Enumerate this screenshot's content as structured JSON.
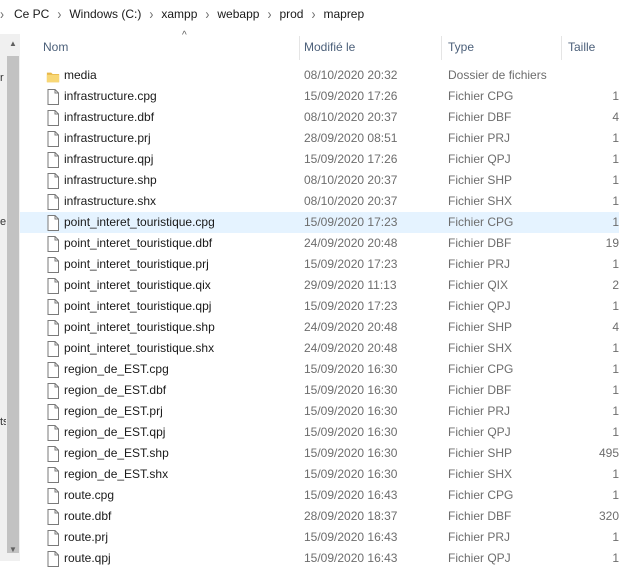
{
  "breadcrumb": [
    "Ce PC",
    "Windows (C:)",
    "xampp",
    "webapp",
    "prod",
    "maprep"
  ],
  "left_edge": [
    "r",
    "el",
    "ts"
  ],
  "columns": {
    "name": "Nom",
    "modified": "Modifié le",
    "type": "Type",
    "size": "Taille"
  },
  "files": [
    {
      "name": "media",
      "modified": "08/10/2020 20:32",
      "type": "Dossier de fichiers",
      "size": "",
      "icon": "folder-icon",
      "selected": false
    },
    {
      "name": "infrastructure.cpg",
      "modified": "15/09/2020 17:26",
      "type": "Fichier CPG",
      "size": "1",
      "icon": "file-icon",
      "selected": false
    },
    {
      "name": "infrastructure.dbf",
      "modified": "08/10/2020 20:37",
      "type": "Fichier DBF",
      "size": "4",
      "icon": "file-icon",
      "selected": false
    },
    {
      "name": "infrastructure.prj",
      "modified": "28/09/2020 08:51",
      "type": "Fichier PRJ",
      "size": "1",
      "icon": "file-icon",
      "selected": false
    },
    {
      "name": "infrastructure.qpj",
      "modified": "15/09/2020 17:26",
      "type": "Fichier QPJ",
      "size": "1",
      "icon": "file-icon",
      "selected": false
    },
    {
      "name": "infrastructure.shp",
      "modified": "08/10/2020 20:37",
      "type": "Fichier SHP",
      "size": "1",
      "icon": "file-icon",
      "selected": false
    },
    {
      "name": "infrastructure.shx",
      "modified": "08/10/2020 20:37",
      "type": "Fichier SHX",
      "size": "1",
      "icon": "file-icon",
      "selected": false
    },
    {
      "name": "point_interet_touristique.cpg",
      "modified": "15/09/2020 17:23",
      "type": "Fichier CPG",
      "size": "1",
      "icon": "file-icon",
      "selected": true
    },
    {
      "name": "point_interet_touristique.dbf",
      "modified": "24/09/2020 20:48",
      "type": "Fichier DBF",
      "size": "19",
      "icon": "file-icon",
      "selected": false
    },
    {
      "name": "point_interet_touristique.prj",
      "modified": "15/09/2020 17:23",
      "type": "Fichier PRJ",
      "size": "1",
      "icon": "file-icon",
      "selected": false
    },
    {
      "name": "point_interet_touristique.qix",
      "modified": "29/09/2020 11:13",
      "type": "Fichier QIX",
      "size": "2",
      "icon": "file-icon",
      "selected": false
    },
    {
      "name": "point_interet_touristique.qpj",
      "modified": "15/09/2020 17:23",
      "type": "Fichier QPJ",
      "size": "1",
      "icon": "file-icon",
      "selected": false
    },
    {
      "name": "point_interet_touristique.shp",
      "modified": "24/09/2020 20:48",
      "type": "Fichier SHP",
      "size": "4",
      "icon": "file-icon",
      "selected": false
    },
    {
      "name": "point_interet_touristique.shx",
      "modified": "24/09/2020 20:48",
      "type": "Fichier SHX",
      "size": "1",
      "icon": "file-icon",
      "selected": false
    },
    {
      "name": "region_de_EST.cpg",
      "modified": "15/09/2020 16:30",
      "type": "Fichier CPG",
      "size": "1",
      "icon": "file-icon",
      "selected": false
    },
    {
      "name": "region_de_EST.dbf",
      "modified": "15/09/2020 16:30",
      "type": "Fichier DBF",
      "size": "1",
      "icon": "file-icon",
      "selected": false
    },
    {
      "name": "region_de_EST.prj",
      "modified": "15/09/2020 16:30",
      "type": "Fichier PRJ",
      "size": "1",
      "icon": "file-icon",
      "selected": false
    },
    {
      "name": "region_de_EST.qpj",
      "modified": "15/09/2020 16:30",
      "type": "Fichier QPJ",
      "size": "1",
      "icon": "file-icon",
      "selected": false
    },
    {
      "name": "region_de_EST.shp",
      "modified": "15/09/2020 16:30",
      "type": "Fichier SHP",
      "size": "495",
      "icon": "file-icon",
      "selected": false
    },
    {
      "name": "region_de_EST.shx",
      "modified": "15/09/2020 16:30",
      "type": "Fichier SHX",
      "size": "1",
      "icon": "file-icon",
      "selected": false
    },
    {
      "name": "route.cpg",
      "modified": "15/09/2020 16:43",
      "type": "Fichier CPG",
      "size": "1",
      "icon": "file-icon",
      "selected": false
    },
    {
      "name": "route.dbf",
      "modified": "28/09/2020 18:37",
      "type": "Fichier DBF",
      "size": "320",
      "icon": "file-icon",
      "selected": false
    },
    {
      "name": "route.prj",
      "modified": "15/09/2020 16:43",
      "type": "Fichier PRJ",
      "size": "1",
      "icon": "file-icon",
      "selected": false
    },
    {
      "name": "route.qpj",
      "modified": "15/09/2020 16:43",
      "type": "Fichier QPJ",
      "size": "1",
      "icon": "file-icon",
      "selected": false
    }
  ],
  "colors": {
    "selection": "#e5f3ff",
    "header_text": "#4c607a",
    "folder": "#f8d775"
  }
}
